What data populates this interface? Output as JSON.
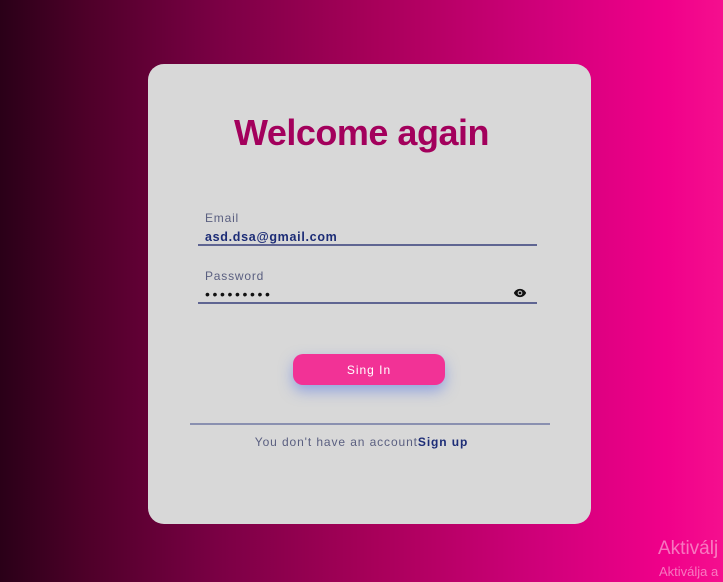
{
  "login": {
    "title": "Welcome again",
    "email": {
      "label": "Email",
      "value": "asd.dsa@gmail.com"
    },
    "password": {
      "label": "Password",
      "masked_value": "•••••••••",
      "toggle_icon": "eye-icon"
    },
    "signin_label": "Sing In",
    "account_prompt": "You don't have an account",
    "signup_label": "Sign up"
  },
  "watermark": {
    "line1": "Aktiválj",
    "line2": "Aktiválja a"
  },
  "colors": {
    "title": "#a3005c",
    "card": "#d8d8d8",
    "button": "#f23296",
    "link": "#1c2c76"
  }
}
